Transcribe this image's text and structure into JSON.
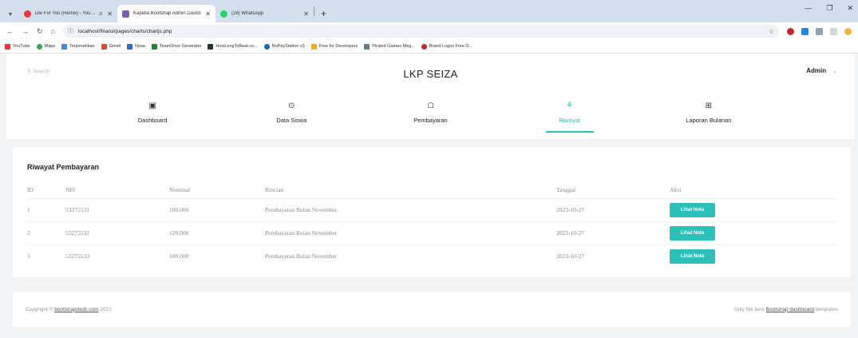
{
  "browser": {
    "tabs": [
      {
        "title": "Die For You (Remix) - YouTube",
        "favicon_color": "#e53935"
      },
      {
        "title": "Kapella Bootstrap Admin Dashb",
        "favicon_color": "#7b5cc4"
      },
      {
        "title": "(28) WhatsApp",
        "favicon_color": "#25d366"
      }
    ],
    "new_tab": "+",
    "url": "localhost/fina/ui/pages/charts/chartjs.php",
    "bookmarks": [
      {
        "label": "YouTube",
        "color": "#e53935"
      },
      {
        "label": "Maps",
        "color": "#34a853"
      },
      {
        "label": "Terjemahkan",
        "color": "#4285f4"
      },
      {
        "label": "Gmail",
        "color": "#ea4335"
      },
      {
        "label": "Nyaa",
        "color": "#3367d6"
      },
      {
        "label": "TeamDrive Generator",
        "color": "#2e7d32"
      },
      {
        "label": "HowLongToBeat.co...",
        "color": "#263238"
      },
      {
        "label": "NoPayStation v3",
        "color": "#1565c0"
      },
      {
        "label": "Free for Developers",
        "color": "#f9a825"
      },
      {
        "label": "Pirated Games Meg...",
        "color": "#607d8b"
      },
      {
        "label": "Brand Logos Free D...",
        "color": "#c62828"
      }
    ]
  },
  "app": {
    "search_placeholder": "Search",
    "brand": "LKP SEIZA",
    "user": "Admin",
    "menu": [
      {
        "label": "Dashboard",
        "icon": "▣"
      },
      {
        "label": "Data Siswa",
        "icon": "⊙"
      },
      {
        "label": "Pembayaran",
        "icon": "☖"
      },
      {
        "label": "Riwayat",
        "icon": "⚘"
      },
      {
        "label": "Laporan Bulanan",
        "icon": "⊞"
      }
    ],
    "accent_color": "#2bc0b8"
  },
  "history": {
    "title": "Riwayat Pembayaran",
    "columns": [
      "ID",
      "NIS",
      "Nominal",
      "Rincian",
      "Tanggal",
      "Aksi"
    ],
    "rows": [
      [
        "1",
        "53275531",
        "100.000",
        "Pembayaran Bulan November",
        "2023-10-27"
      ],
      [
        "2",
        "53275532",
        "120.000",
        "Pembayaran Bulan November",
        "2023-10-27"
      ],
      [
        "3",
        "53275533",
        "100.000",
        "Pembayaran Bulan November",
        "2023-10-27"
      ]
    ],
    "action_label": "Lihat Nota"
  },
  "footer": {
    "copyright_prefix": "Copyright ©",
    "copyright_link": "bootstrapdash.com",
    "copyright_year": "2021",
    "right_prefix": "Only the best",
    "right_link": "Bootstrap dashboard",
    "right_suffix": "templates"
  }
}
